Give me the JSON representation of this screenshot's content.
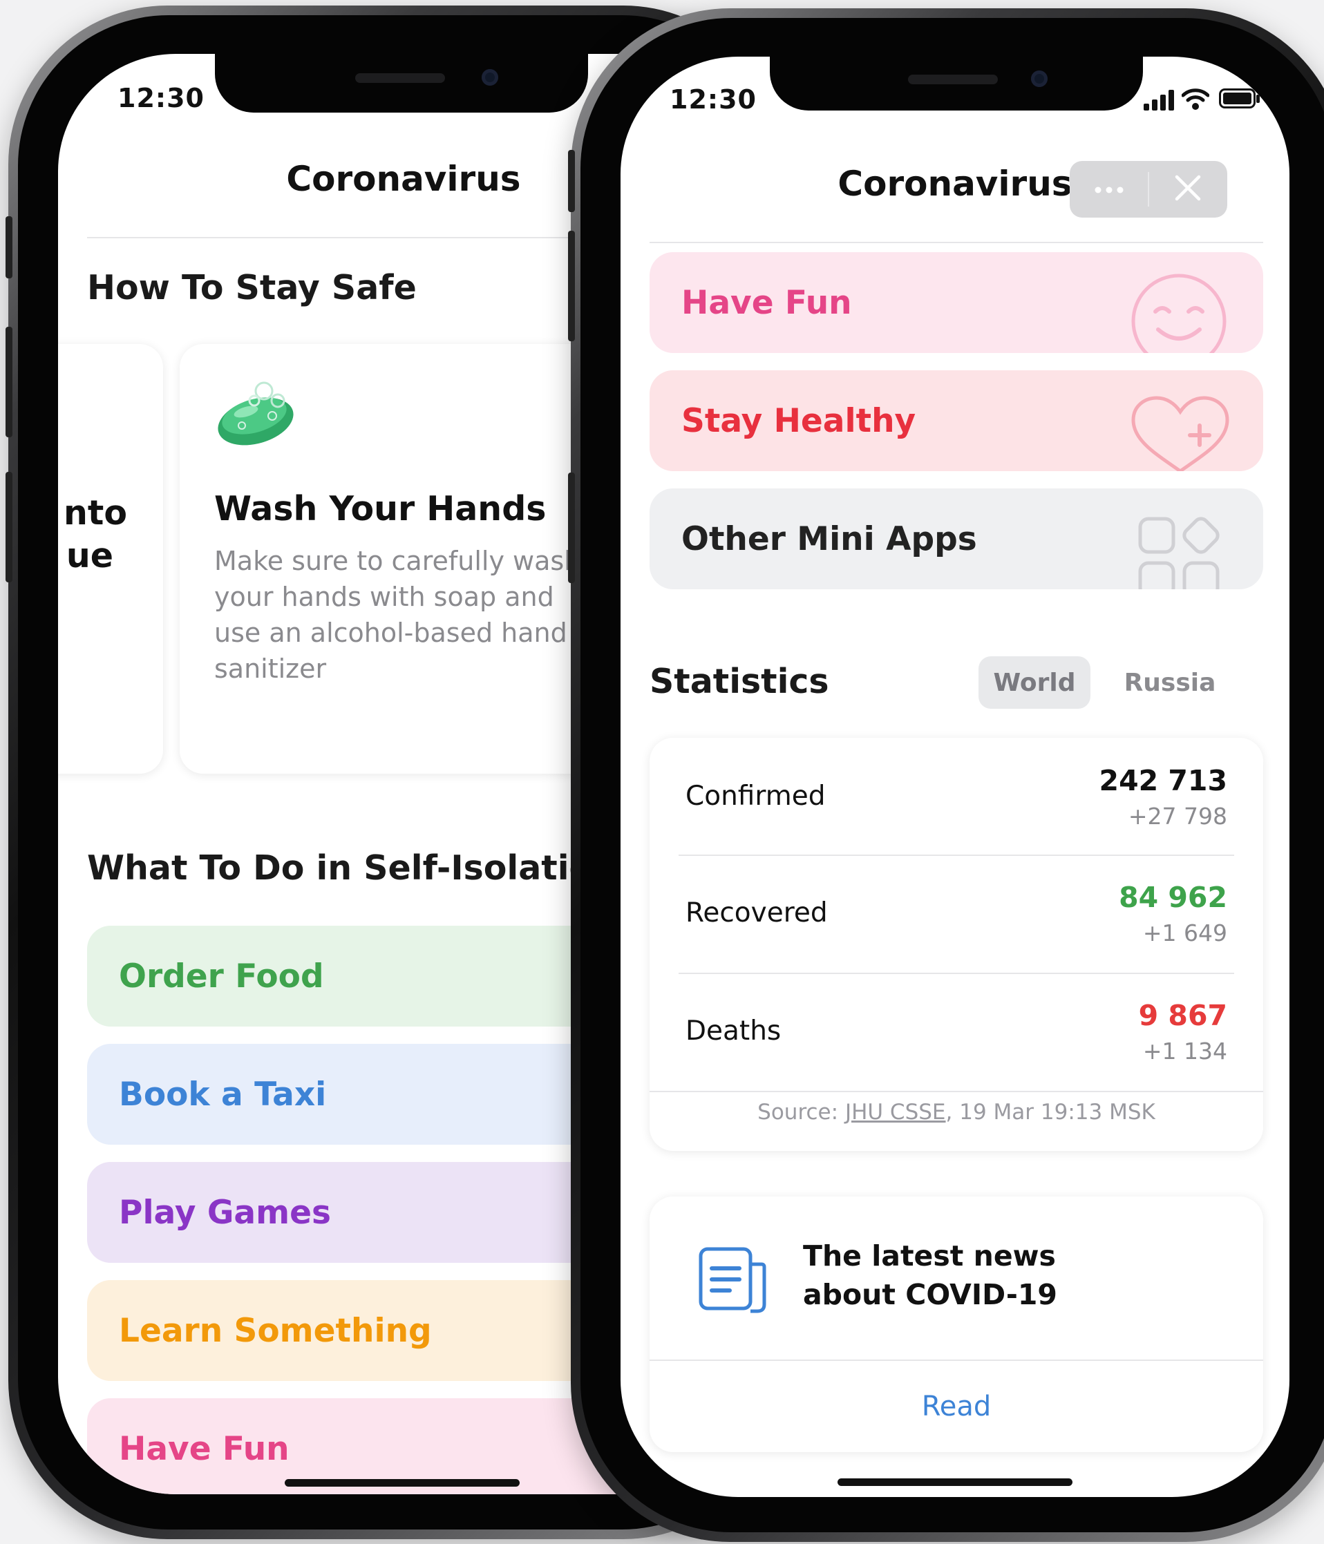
{
  "left_phone": {
    "status_time": "12:30",
    "nav_title": "Coronavirus",
    "stay_safe": {
      "title": "How To Stay Safe",
      "partial_card_text": [
        "nto",
        "ue"
      ],
      "card": {
        "title": "Wash Your Hands",
        "body": "Make sure to carefully wash your hands with soap and use an alcohol-based hand sanitizer"
      }
    },
    "self_isolation": {
      "title": "What To Do in Self-Isolation",
      "items": [
        {
          "label": "Order Food",
          "color": "#3fa34d",
          "bg": "#e6f4e7"
        },
        {
          "label": "Book a Taxi",
          "color": "#3d83d6",
          "bg": "#e7eefb"
        },
        {
          "label": "Play Games",
          "color": "#8a35c6",
          "bg": "#ece3f6"
        },
        {
          "label": "Learn Something",
          "color": "#f2990a",
          "bg": "#fdf0dc"
        },
        {
          "label": "Have Fun",
          "color": "#e54587",
          "bg": "#fce4ee"
        }
      ]
    }
  },
  "right_phone": {
    "status_time": "12:30",
    "nav_title": "Coronavirus",
    "more_icon": "ellipsis-icon",
    "close_icon": "close-icon",
    "menu": [
      {
        "label": "Have Fun",
        "color": "#e54587",
        "bg": "#fde6ee",
        "icon": "smiley-icon"
      },
      {
        "label": "Stay Healthy",
        "color": "#e8303e",
        "bg": "#fde3e6",
        "icon": "heart-plus-icon"
      },
      {
        "label": "Other Mini Apps",
        "color": "#222222",
        "bg": "#eff0f2",
        "icon": "apps-grid-icon"
      }
    ],
    "statistics": {
      "title": "Statistics",
      "tabs": [
        {
          "label": "World",
          "selected": true
        },
        {
          "label": "Russia",
          "selected": false
        }
      ],
      "rows": [
        {
          "label": "Confirmed",
          "value": "242 713",
          "delta": "+27 798",
          "color": "#111111"
        },
        {
          "label": "Recovered",
          "value": "84 962",
          "delta": "+1 649",
          "color": "#3ea34b"
        },
        {
          "label": "Deaths",
          "value": "9 867",
          "delta": "+1 134",
          "color": "#e63b3b"
        }
      ],
      "source_prefix": "Source: ",
      "source_link": "JHU CSSE",
      "source_suffix": ", 19 Mar 19:13 MSK"
    },
    "news": {
      "title_line1": "The latest news",
      "title_line2": "about COVID-19",
      "icon": "document-icon",
      "button": "Read"
    }
  },
  "colors": {
    "accent_blue": "#3d83d6",
    "secondary_text": "#8a8a8e"
  }
}
